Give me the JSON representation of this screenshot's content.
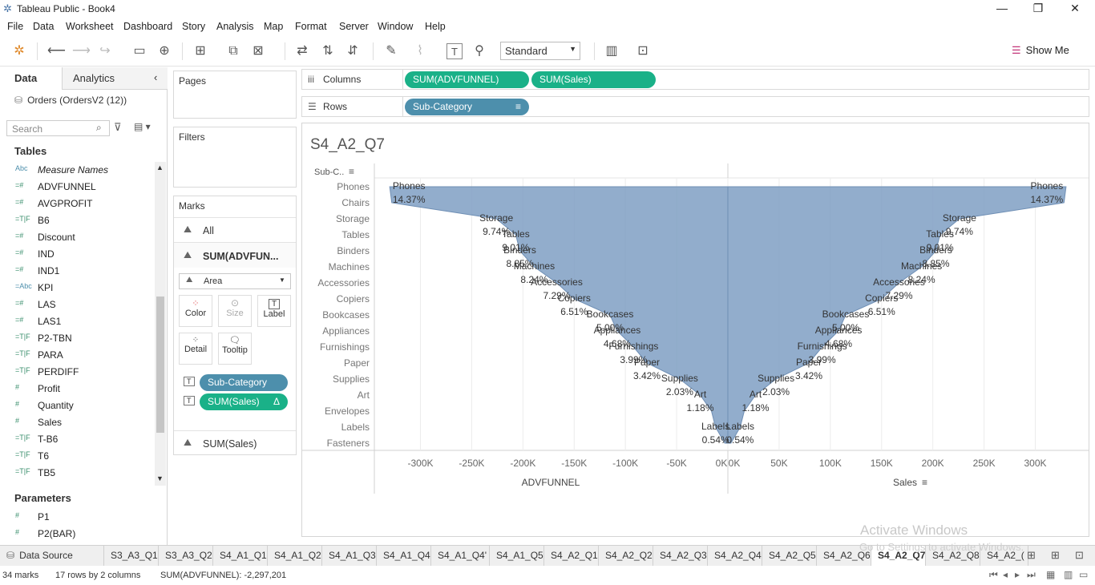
{
  "window": {
    "title": "Tableau Public - Book4",
    "minimize": "—",
    "restore": "❐",
    "close": "✕"
  },
  "menu": [
    "File",
    "Data",
    "Worksheet",
    "Dashboard",
    "Story",
    "Analysis",
    "Map",
    "Format",
    "Server",
    "Window",
    "Help"
  ],
  "toolbar": {
    "fit": "Standard",
    "show_me": "Show Me"
  },
  "left": {
    "tab_data": "Data",
    "tab_analytics": "Analytics",
    "datasource": "Orders (OrdersV2 (12))",
    "search_placeholder": "Search",
    "tables_header": "Tables",
    "fields": [
      {
        "icon": "Abc",
        "name": "Measure Names",
        "italic": true
      },
      {
        "icon": "=#",
        "name": "ADVFUNNEL"
      },
      {
        "icon": "=#",
        "name": "AVGPROFIT"
      },
      {
        "icon": "=T|F",
        "name": "B6"
      },
      {
        "icon": "=#",
        "name": "Discount"
      },
      {
        "icon": "=#",
        "name": "IND"
      },
      {
        "icon": "=#",
        "name": "IND1"
      },
      {
        "icon": "=Abc",
        "name": "KPI"
      },
      {
        "icon": "=#",
        "name": "LAS"
      },
      {
        "icon": "=#",
        "name": "LAS1"
      },
      {
        "icon": "=T|F",
        "name": "P2-TBN"
      },
      {
        "icon": "=T|F",
        "name": "PARA"
      },
      {
        "icon": "=T|F",
        "name": "PERDIFF"
      },
      {
        "icon": "#",
        "name": "Profit"
      },
      {
        "icon": "#",
        "name": "Quantity"
      },
      {
        "icon": "#",
        "name": "Sales"
      },
      {
        "icon": "=T|F",
        "name": "T-B6"
      },
      {
        "icon": "=T|F",
        "name": "T6"
      },
      {
        "icon": "=T|F",
        "name": "TB5"
      }
    ],
    "params_header": "Parameters",
    "params": [
      {
        "icon": "#",
        "name": "P1"
      },
      {
        "icon": "#",
        "name": "P2(BAR)"
      }
    ]
  },
  "cards": {
    "pages": "Pages",
    "filters": "Filters",
    "marks": "Marks",
    "all": "All",
    "sum_adv": "SUM(ADVFUN...",
    "mark_type": "Area",
    "buttons": [
      "Color",
      "Size",
      "Label",
      "Detail",
      "Tooltip"
    ],
    "pill_subcat": "Sub-Category",
    "pill_sales": "SUM(Sales)",
    "delta": "Δ",
    "sum_sales": "SUM(Sales)"
  },
  "shelves": {
    "columns_label": "Columns",
    "rows_label": "Rows",
    "col_pills": [
      "SUM(ADVFUNNEL)",
      "SUM(Sales)"
    ],
    "row_pill": "Sub-Category"
  },
  "chart_data": {
    "type": "area",
    "title": "S4_A2_Q7",
    "row_header": "Sub-C..",
    "categories": [
      "Phones",
      "Chairs",
      "Storage",
      "Tables",
      "Binders",
      "Machines",
      "Accessories",
      "Copiers",
      "Bookcases",
      "Appliances",
      "Furnishings",
      "Paper",
      "Supplies",
      "Art",
      "Envelopes",
      "Labels",
      "Fasteners"
    ],
    "sales_k": [
      330,
      328,
      226,
      207,
      203,
      189,
      167,
      150,
      115,
      108,
      92,
      79,
      47,
      27,
      16,
      12,
      3
    ],
    "advfunnel_k": [
      -330,
      -328,
      -226,
      -207,
      -203,
      -189,
      -167,
      -150,
      -115,
      -108,
      -92,
      -79,
      -47,
      -27,
      -16,
      -12,
      -3
    ],
    "labels": [
      {
        "cat": "Phones",
        "pct": "14.37%"
      },
      {
        "cat": "Storage",
        "pct": "9.74%"
      },
      {
        "cat": "Binders",
        "pct": "8.85%"
      },
      {
        "cat": "Tables",
        "pct": "9.01%"
      },
      {
        "cat": "Machines",
        "pct": "8.24%"
      },
      {
        "cat": "Accessories",
        "pct": "7.29%"
      },
      {
        "cat": "Copiers",
        "pct": "6.51%"
      },
      {
        "cat": "Bookcases",
        "pct": "5.00%"
      },
      {
        "cat": "Appliances",
        "pct": "4.68%"
      },
      {
        "cat": "Furnishings",
        "pct": "3.99%"
      },
      {
        "cat": "Paper",
        "pct": "3.42%"
      },
      {
        "cat": "Supplies",
        "pct": "2.03%"
      },
      {
        "cat": "Art",
        "pct": "1.18%"
      },
      {
        "cat": "Labels",
        "pct": "0.54%"
      }
    ],
    "left_axis": {
      "title": "ADVFUNNEL",
      "ticks": [
        "-300K",
        "-250K",
        "-200K",
        "-150K",
        "-100K",
        "-50K",
        "0K"
      ],
      "tick_values": [
        -300,
        -250,
        -200,
        -150,
        -100,
        -50,
        0
      ]
    },
    "right_axis": {
      "title": "Sales",
      "ticks": [
        "0K",
        "50K",
        "100K",
        "150K",
        "200K",
        "250K",
        "300K"
      ],
      "tick_values": [
        0,
        50,
        100,
        150,
        200,
        250,
        300
      ]
    },
    "color": "#7f9fc3"
  },
  "sheets": [
    "S3_A3_Q1",
    "S3_A3_Q2",
    "S4_A1_Q1",
    "S4_A1_Q2",
    "S4_A1_Q3",
    "S4_A1_Q4",
    "S4_A1_Q4'",
    "S4_A1_Q5",
    "S4_A2_Q1",
    "S4_A2_Q2",
    "S4_A2_Q3",
    "S4_A2_Q4",
    "S4_A2_Q5",
    "S4_A2_Q6",
    "S4_A2_Q7",
    "S4_A2_Q8",
    "S4_A2_("
  ],
  "active_sheet": "S4_A2_Q7",
  "datasource_tab": "Data Source",
  "status": {
    "marks": "34 marks",
    "rows": "17 rows by 2 columns",
    "sum": "SUM(ADVFUNNEL): -2,297,201"
  },
  "watermark": {
    "line1": "Activate Windows",
    "line2": "Go to Settings to activate Windows."
  }
}
